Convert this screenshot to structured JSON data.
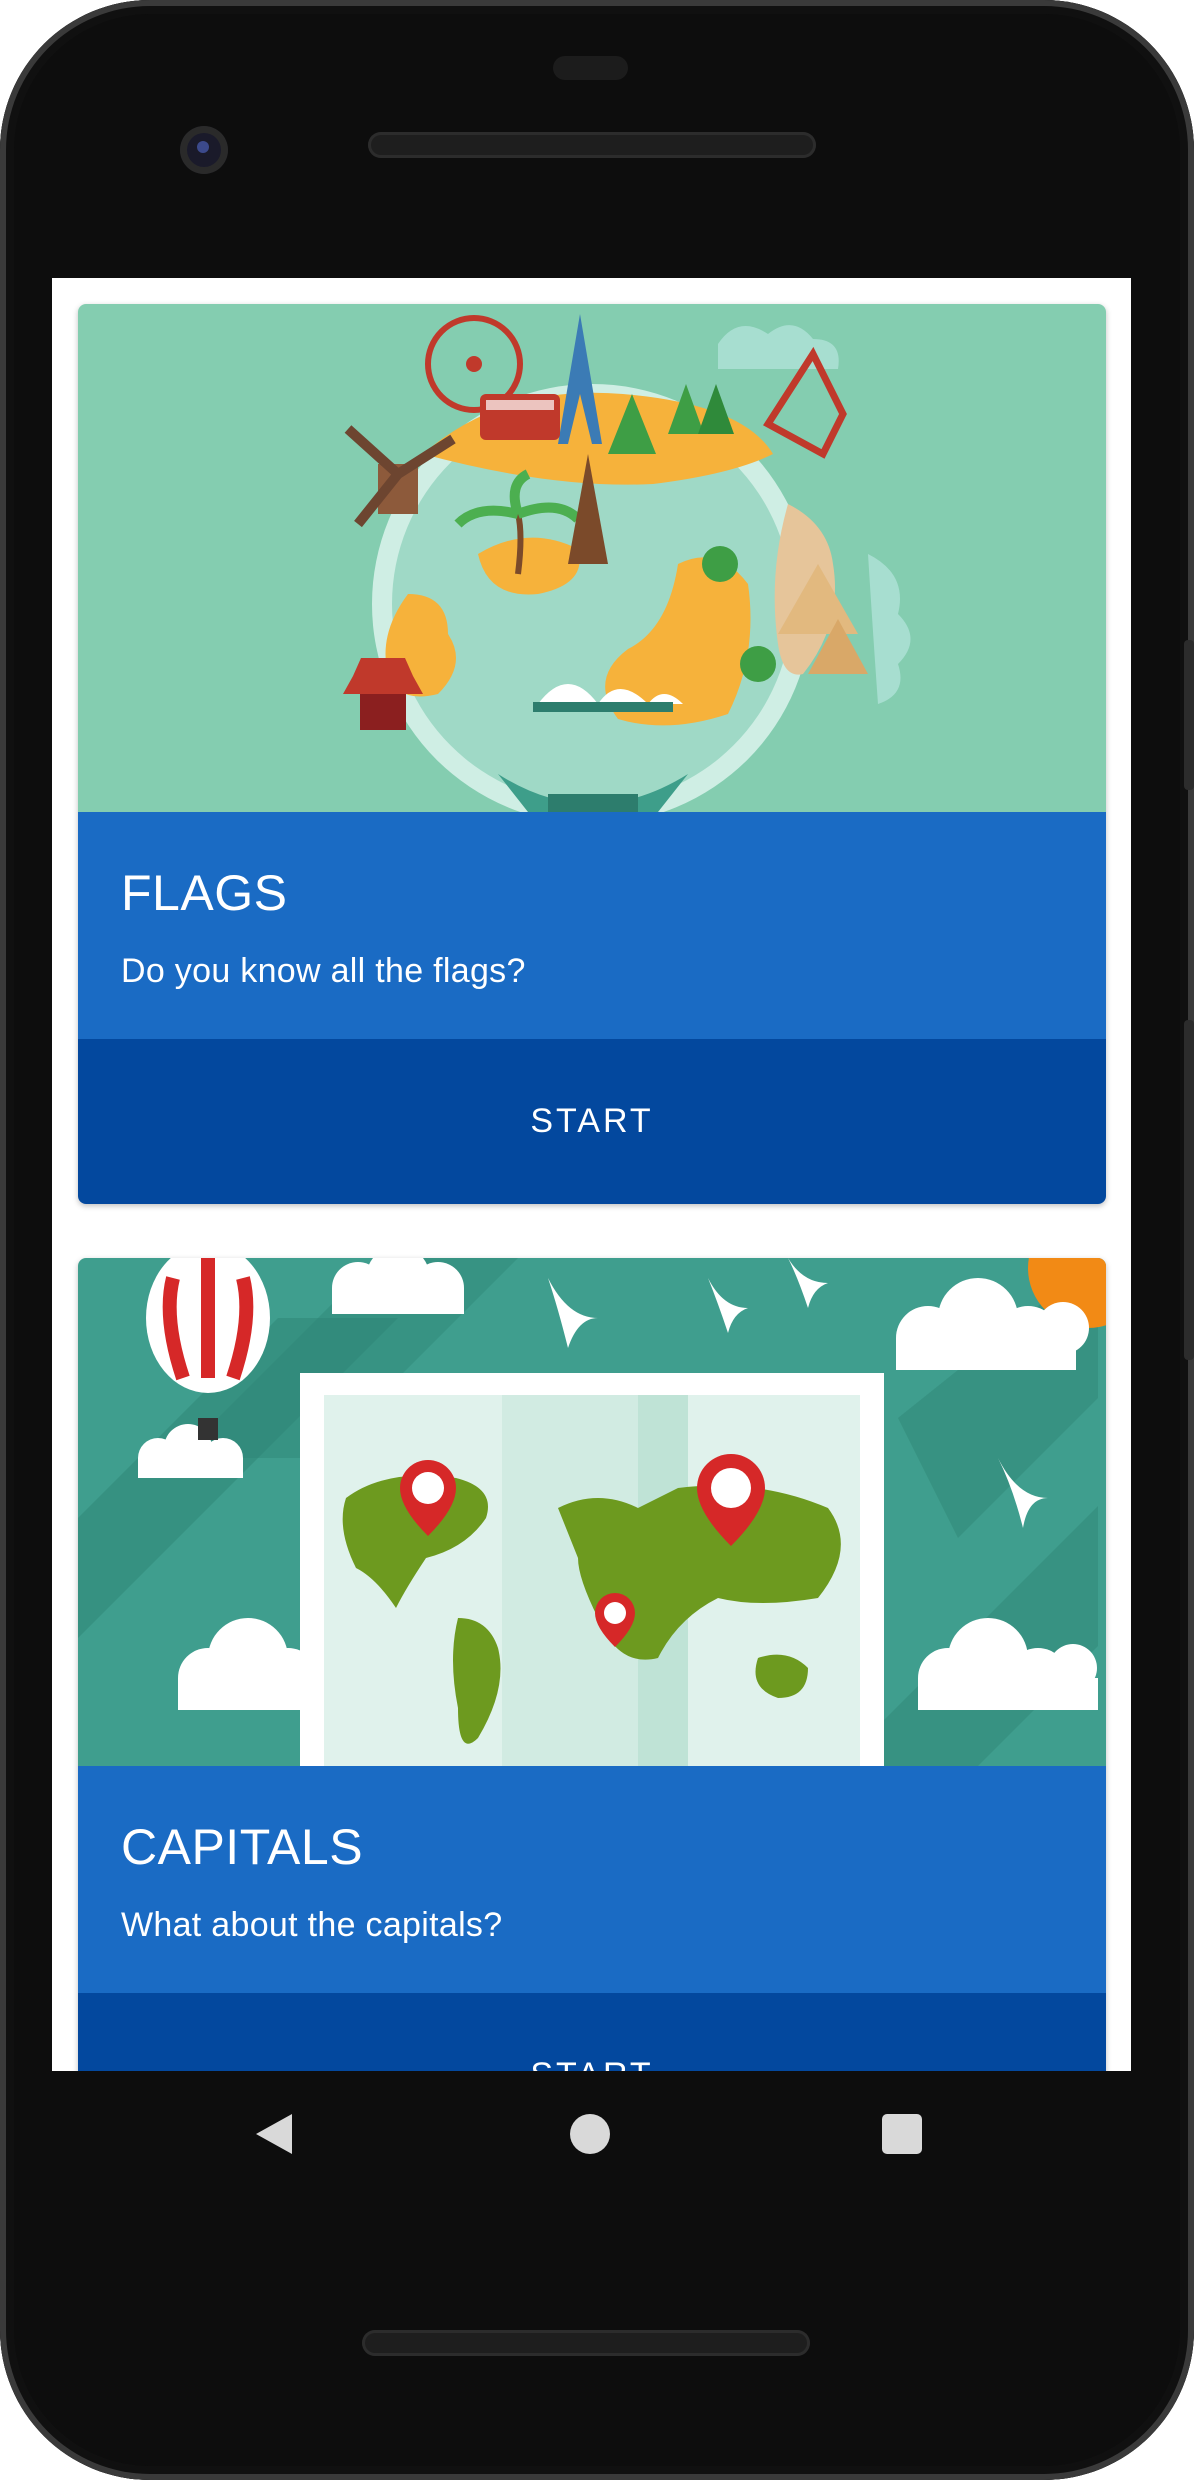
{
  "cards": [
    {
      "title": "FLAGS",
      "subtitle": "Do you know all the flags?",
      "button_label": "START",
      "image": "world-landmarks-globe-illustration"
    },
    {
      "title": "CAPITALS",
      "subtitle": "What about the capitals?",
      "button_label": "START",
      "image": "world-map-pins-illustration"
    }
  ],
  "nav_bar": {
    "back_icon": "triangle-back-icon",
    "home_icon": "circle-home-icon",
    "recents_icon": "square-recents-icon"
  },
  "colors": {
    "card_info_bg": "#1a6bc4",
    "button_bg": "#03489e",
    "hero1_bg": "#84cdb0",
    "hero2_bg": "#3f9e8e"
  }
}
